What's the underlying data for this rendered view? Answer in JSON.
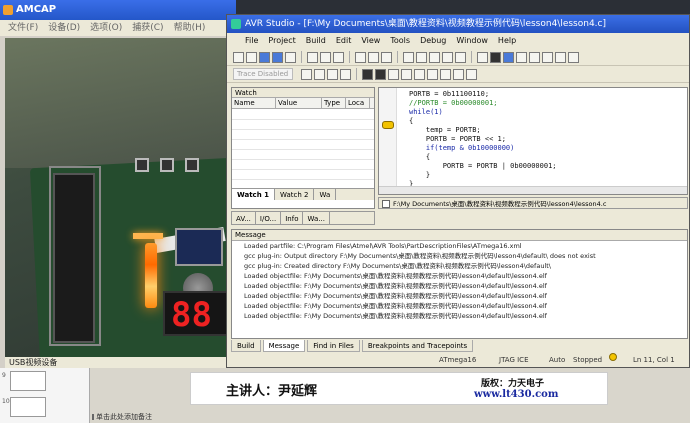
{
  "amcap": {
    "title": "AMCAP",
    "menu": [
      "文件(F)",
      "设备(D)",
      "选项(O)",
      "捕获(C)",
      "帮助(H)"
    ],
    "status": "USB视频设备"
  },
  "avr": {
    "title": "AVR Studio - [F:\\My Documents\\桌面\\教程资料\\视频教程示例代码\\lesson4\\lesson4.c]",
    "menu": [
      "File",
      "Project",
      "Build",
      "Edit",
      "View",
      "Tools",
      "Debug",
      "Window",
      "Help"
    ],
    "trace_dropdown": "Trace Disabled",
    "watch": {
      "title": "Watch",
      "columns": [
        "Name",
        "Value",
        "Type",
        "Loca"
      ],
      "tabs": [
        "Watch 1",
        "Watch 2",
        "Wa"
      ]
    },
    "pane_tabs": [
      "AV...",
      "I/O...",
      "Info",
      "Wa..."
    ],
    "editor": {
      "lines": [
        {
          "text": "PORTB = 0b11100110;",
          "kind": "plain"
        },
        {
          "text": "//PORTB = 0b00000001;",
          "kind": "comment"
        },
        {
          "text": "while(1)",
          "kind": "kw"
        },
        {
          "text": "{",
          "kind": "plain"
        },
        {
          "text": "    temp = PORTB;",
          "kind": "plain"
        },
        {
          "text": "    PORTB = PORTB << 1;",
          "kind": "plain"
        },
        {
          "text": "    if(temp & 0b10000000)",
          "kind": "kw"
        },
        {
          "text": "    {",
          "kind": "plain"
        },
        {
          "text": "        PORTB = PORTB | 0b00000001;",
          "kind": "plain"
        },
        {
          "text": "    }",
          "kind": "plain"
        },
        {
          "text": "}",
          "kind": "plain"
        }
      ]
    },
    "doc_tab": "F:\\My Documents\\桌面\\教程资料\\视频教程示例代码\\lesson4\\lesson4.c",
    "message": {
      "title": "Message",
      "lines": [
        "Loaded partfile: C:\\Program Files\\Atmel\\AVR Tools\\PartDescriptionFiles\\ATmega16.xml",
        "gcc plug-in: Output directory F:\\My Documents\\桌面\\教程资料\\视频教程示例代码\\lesson4\\default\\ does not exist",
        "gcc plug-in: Created directory F:\\My Documents\\桌面\\教程资料\\视频教程示例代码\\lesson4\\default\\",
        "Loaded objectfile: F:\\My Documents\\桌面\\教程资料\\视频教程示例代码\\lesson4\\default\\lesson4.elf",
        "Loaded objectfile: F:\\My Documents\\桌面\\教程资料\\视频教程示例代码\\lesson4\\default\\lesson4.elf",
        "Loaded objectfile: F:\\My Documents\\桌面\\教程资料\\视频教程示例代码\\lesson4\\default\\lesson4.elf",
        "Loaded objectfile: F:\\My Documents\\桌面\\教程资料\\视频教程示例代码\\lesson4\\default\\lesson4.elf",
        "Loaded objectfile: F:\\My Documents\\桌面\\教程资料\\视频教程示例代码\\lesson4\\default\\lesson4.elf"
      ],
      "tabs": [
        "Build",
        "Message",
        "Find in Files",
        "Breakpoints and Tracepoints"
      ]
    },
    "status": {
      "device": "ATmega16",
      "tool": "JTAG ICE",
      "mode": "Auto",
      "state": "Stopped",
      "position": "Ln 11, Col 1"
    }
  },
  "slide": {
    "lecturer": "主讲人：尹延辉",
    "copyright": "版权：力天电子",
    "website": "www.lt430.com",
    "notes_placeholder": "单击此处添加备注",
    "thumb_numbers": [
      "9",
      "10"
    ]
  },
  "display_digits": "88"
}
